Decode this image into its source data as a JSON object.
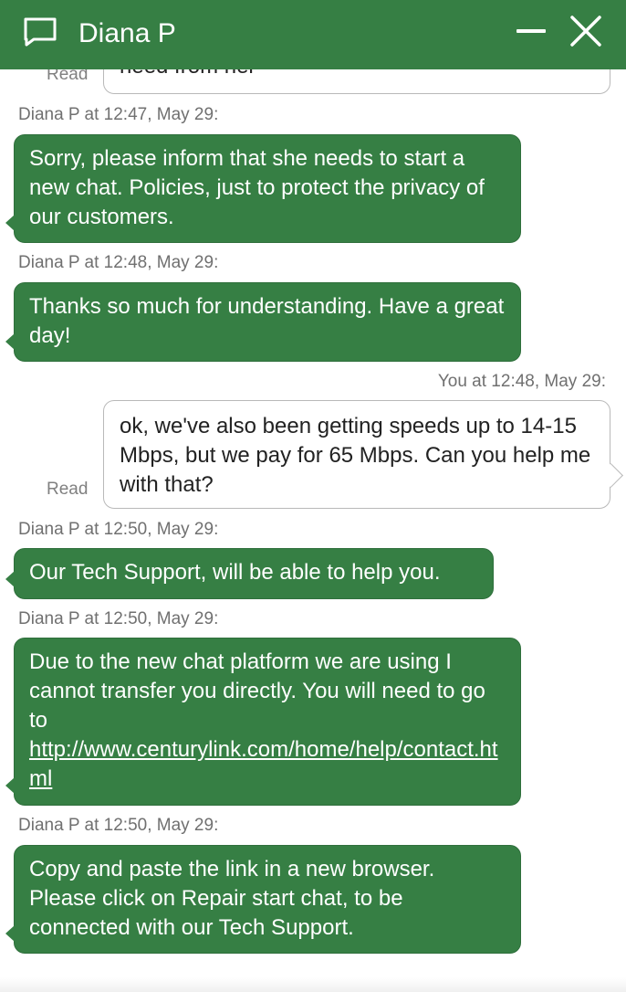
{
  "header": {
    "title": "Diana P",
    "minimize_icon": "minimize-icon",
    "close_icon": "close-icon",
    "chat_icon": "chat-bubble-icon",
    "color": "#367f44"
  },
  "partial_top": {
    "read_label": "Read",
    "text": "need from her"
  },
  "messages": [
    {
      "sender": "agent",
      "meta": "Diana P at 12:47, May 29:",
      "text": "Sorry, please inform that she needs to start a new chat. Policies, just to protect the privacy of our customers."
    },
    {
      "sender": "agent",
      "meta": "Diana P at 12:48, May 29:",
      "text": "Thanks so much for understanding. Have a great day!"
    },
    {
      "sender": "user",
      "meta": "You at 12:48, May 29:",
      "text": "ok, we've also been getting speeds up to 14-15 Mbps, but we pay for 65 Mbps. Can you help me with that?",
      "read_label": "Read"
    },
    {
      "sender": "agent",
      "meta": "Diana P at 12:50, May 29:",
      "text": "Our Tech Support, will be able to help you."
    },
    {
      "sender": "agent",
      "meta": "Diana P at 12:50, May 29:",
      "text_before_link": "Due to the new chat platform we are using I cannot transfer you directly.  You will need to go to",
      "link": "http://www.centurylink.com/home/help/contact.html"
    },
    {
      "sender": "agent",
      "meta": "Diana P at 12:50, May 29:",
      "text": "Copy and paste the link in a new browser. Please click on Repair start chat, to be connected with our Tech Support."
    }
  ]
}
